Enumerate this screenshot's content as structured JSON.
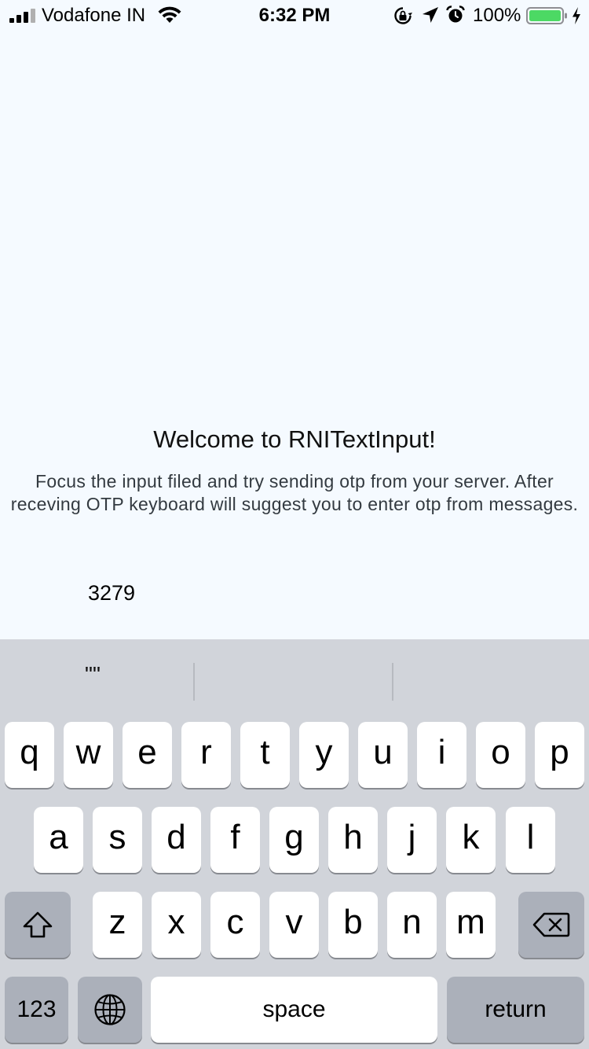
{
  "status_bar": {
    "carrier": "Vodafone IN",
    "time": "6:32 PM",
    "battery_percent": "100%",
    "battery_level": 1.0,
    "icons": [
      "signal-icon",
      "wifi-icon",
      "rotation-lock-icon",
      "location-arrow-icon",
      "alarm-icon",
      "battery-icon",
      "charging-bolt-icon"
    ]
  },
  "content": {
    "title": "Welcome to RNITextInput!",
    "instructions": "Focus the input filed and try sending otp from your server. After receving OTP keyboard will suggest you to enter otp from messages.",
    "otp_value": "3279"
  },
  "keyboard": {
    "suggestions": [
      "\"\"",
      "",
      ""
    ],
    "row1": [
      "q",
      "w",
      "e",
      "r",
      "t",
      "y",
      "u",
      "i",
      "o",
      "p"
    ],
    "row2": [
      "a",
      "s",
      "d",
      "f",
      "g",
      "h",
      "j",
      "k",
      "l"
    ],
    "row3": [
      "z",
      "x",
      "c",
      "v",
      "b",
      "n",
      "m"
    ],
    "numbers_label": "123",
    "space_label": "space",
    "return_label": "return",
    "icons": [
      "shift-icon",
      "backspace-icon",
      "globe-icon"
    ]
  },
  "colors": {
    "background": "#F5FAFF",
    "keyboard_background": "#D1D4DA",
    "key": "#FFFFFF",
    "dark_key": "#ABB0BA",
    "battery_fill": "#4CD964"
  }
}
